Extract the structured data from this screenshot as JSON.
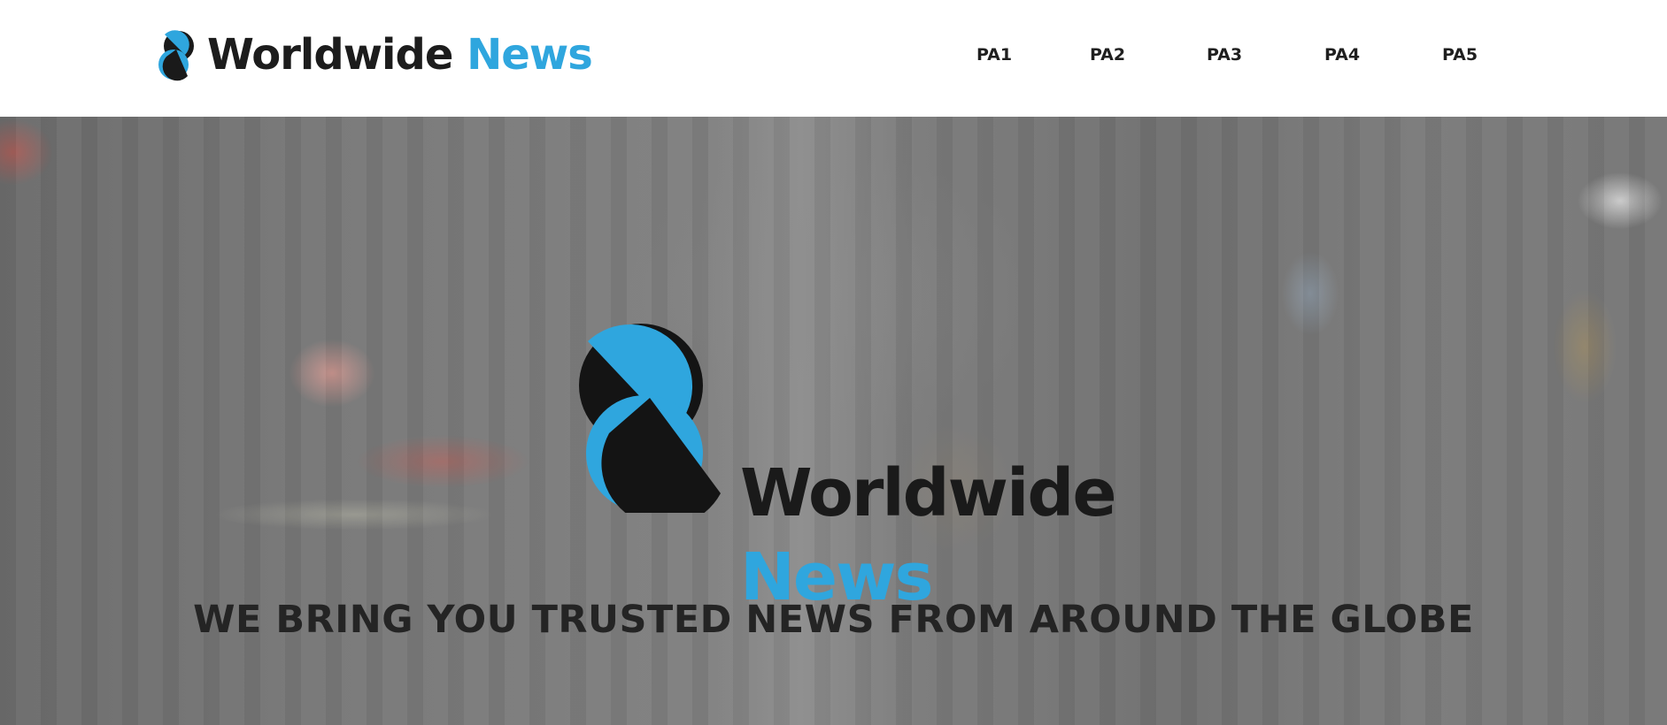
{
  "brand": {
    "name_part1": "Worldwide",
    "name_part2": "News",
    "logo_icon": "worldwide-news-logo-icon"
  },
  "nav": {
    "items": [
      "PA1",
      "PA2",
      "PA3",
      "PA4",
      "PA5"
    ]
  },
  "hero": {
    "logo_line1": "Worldwide",
    "logo_line2": "News",
    "tagline": "WE BRING YOU TRUSTED NEWS FROM AROUND THE GLOBE"
  },
  "colors": {
    "brand_blue": "#2fa6de",
    "brand_dark": "#1c1c1c",
    "header_bg": "#ffffff"
  }
}
